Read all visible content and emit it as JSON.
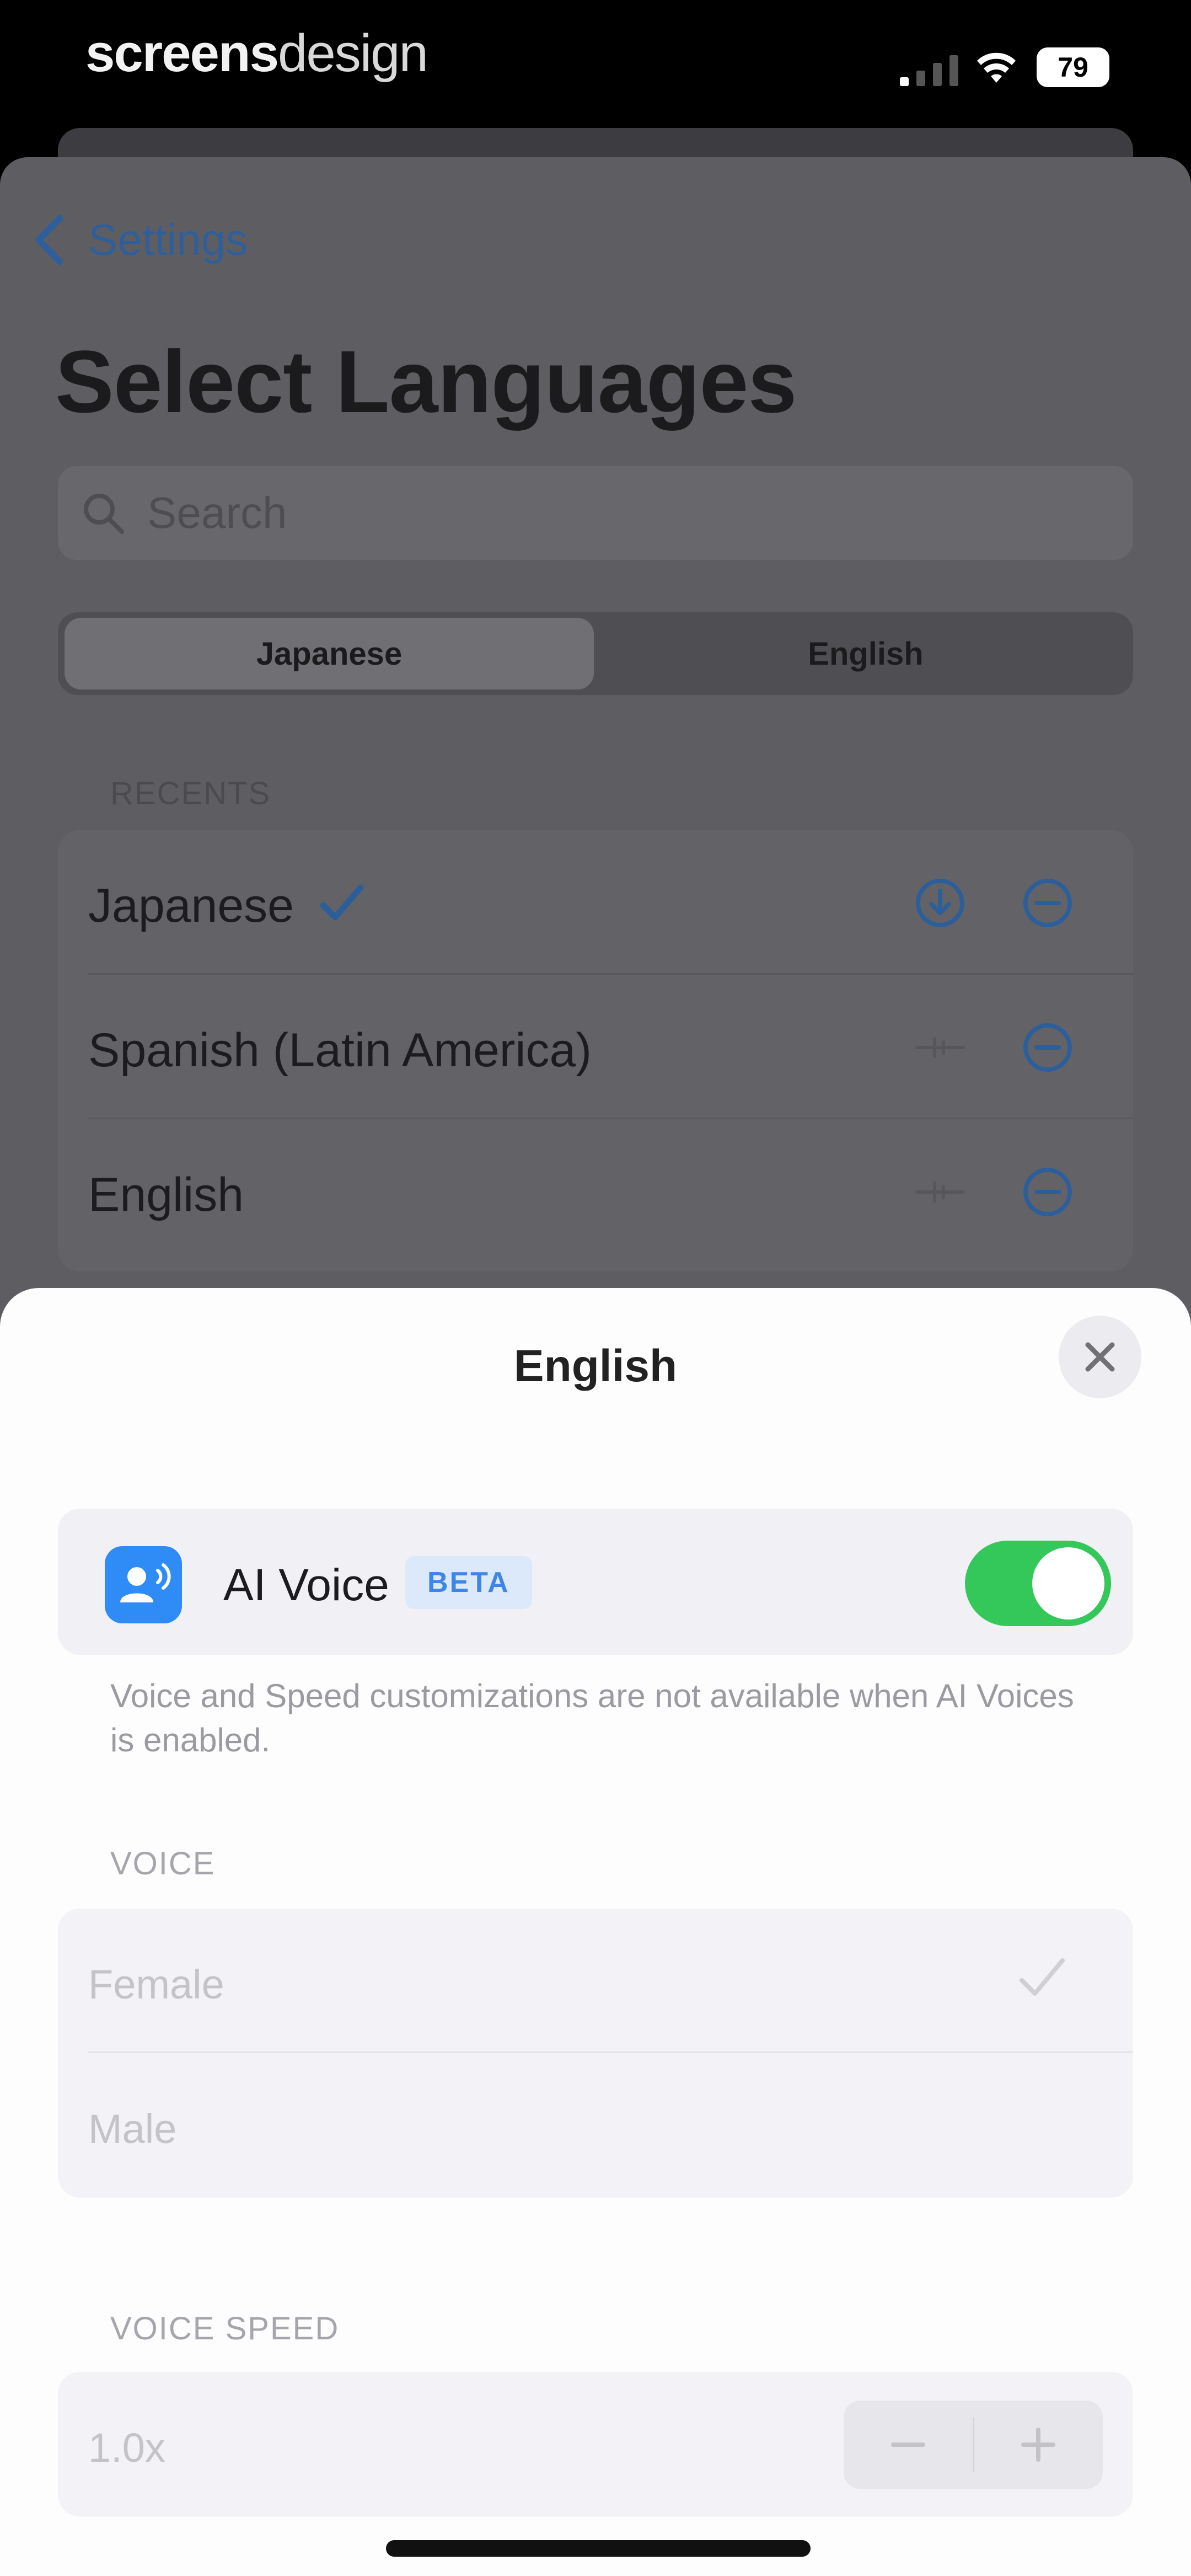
{
  "status_bar": {
    "watermark_bold": "screens",
    "watermark_light": "design",
    "battery": "79"
  },
  "nav": {
    "back_label": "Settings"
  },
  "page": {
    "title": "Select Languages"
  },
  "search": {
    "placeholder": "Search"
  },
  "segments": [
    "Japanese",
    "English"
  ],
  "recents": {
    "header": "RECENTS",
    "items": [
      {
        "label": "Japanese",
        "selected": true
      },
      {
        "label": "Spanish (Latin America)",
        "selected": false
      },
      {
        "label": "English",
        "selected": false
      }
    ]
  },
  "sheet": {
    "title": "English",
    "ai_voice": {
      "label": "AI Voice",
      "badge": "BETA",
      "enabled": true
    },
    "footnote": "Voice and Speed customizations are not available when AI Voices is enabled.",
    "voice": {
      "header": "VOICE",
      "options": [
        {
          "label": "Female",
          "selected": true
        },
        {
          "label": "Male",
          "selected": false
        }
      ]
    },
    "speed": {
      "header": "VOICE SPEED",
      "value": "1.0x"
    }
  },
  "colors": {
    "accent": "#2f8cf6",
    "toggle_on": "#34c759",
    "dim_overlay": "#5e5e62"
  }
}
